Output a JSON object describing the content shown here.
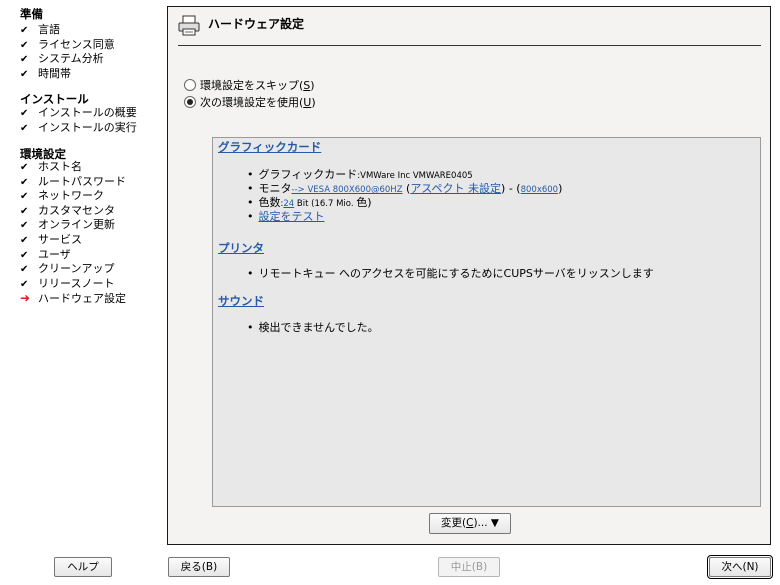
{
  "sidebar": {
    "sections": [
      {
        "title": "準備",
        "items": [
          {
            "label": "言語",
            "state": "done"
          },
          {
            "label": "ライセンス同意",
            "state": "done"
          },
          {
            "label": "システム分析",
            "state": "done"
          },
          {
            "label": "時間帯",
            "state": "done"
          }
        ]
      },
      {
        "title": "インストール",
        "items": [
          {
            "label": "インストールの概要",
            "state": "done"
          },
          {
            "label": "インストールの実行",
            "state": "done"
          }
        ]
      },
      {
        "title": "環境設定",
        "items": [
          {
            "label": "ホスト名",
            "state": "done"
          },
          {
            "label": "ルートパスワード",
            "state": "done"
          },
          {
            "label": "ネットワーク",
            "state": "done"
          },
          {
            "label": "カスタマセンタ",
            "state": "done"
          },
          {
            "label": "オンライン更新",
            "state": "done"
          },
          {
            "label": "サービス",
            "state": "done"
          },
          {
            "label": "ユーザ",
            "state": "done"
          },
          {
            "label": "クリーンアップ",
            "state": "done"
          },
          {
            "label": "リリースノート",
            "state": "done"
          },
          {
            "label": "ハードウェア設定",
            "state": "current"
          }
        ]
      }
    ]
  },
  "main": {
    "title": "ハードウェア設定",
    "radios": [
      {
        "label": "環境設定をスキップ(",
        "key": "S",
        "selected": false
      },
      {
        "label": "次の環境設定を使用(",
        "key": "U",
        "selected": true
      }
    ],
    "graphics": {
      "heading": "グラフィックカード",
      "card_label": "グラフィックカード",
      "card_value": ":VMWare Inc VMWARE0405",
      "monitor_label": "モニタ",
      "monitor_link": "--> VESA 800X600@60HZ",
      "aspect_link": "アスペクト 未設定",
      "resolution_link": "800x600",
      "colors_label": "色数",
      "colors_link": "24",
      "colors_rest": " Bit (16.7 Mio. ",
      "colors_end": "色",
      "test_link": "設定をテスト"
    },
    "printer": {
      "heading": "プリンタ",
      "text": "リモートキュー へのアクセスを可能にするためにCUPSサーバをリッスンします"
    },
    "sound": {
      "heading": "サウンド",
      "text": "検出できませんでした。"
    },
    "change_button": {
      "label": "変更(",
      "key": "C",
      "suffix": ")... ▼"
    }
  },
  "footer": {
    "help": "ヘルプ",
    "back": "戻る(B)",
    "abort": "中止(B)",
    "next": "次へ(N)"
  }
}
